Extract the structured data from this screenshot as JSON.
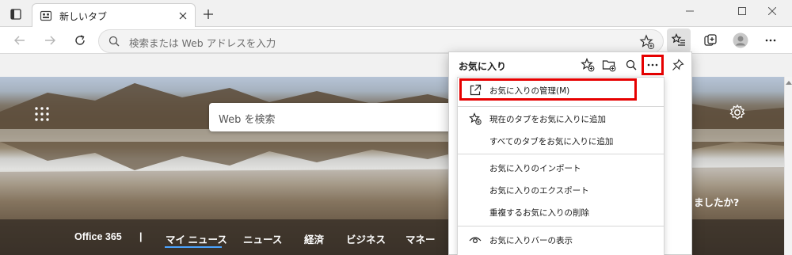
{
  "tab": {
    "title": "新しいタブ"
  },
  "address": {
    "placeholder": "検索または Web アドレスを入力"
  },
  "ntp": {
    "search_placeholder": "Web を検索",
    "teaser_text": "ましたか?",
    "feed": [
      {
        "label": "Office 365"
      },
      {
        "label": "|"
      },
      {
        "label": "マイ ニュース"
      },
      {
        "label": "ニュース"
      },
      {
        "label": "経済"
      },
      {
        "label": "ビジネス"
      },
      {
        "label": "マネー"
      }
    ]
  },
  "favorites": {
    "title": "お気に入り",
    "menu": [
      {
        "label": "お気に入りの管理(M)",
        "icon": "external-link-icon"
      },
      {
        "label": "現在のタブをお気に入りに追加",
        "icon": "star-add-icon"
      },
      {
        "label": "すべてのタブをお気に入りに追加",
        "icon": ""
      },
      {
        "label": "お気に入りのインポート",
        "icon": ""
      },
      {
        "label": "お気に入りのエクスポート",
        "icon": ""
      },
      {
        "label": "重複するお気に入りの削除",
        "icon": ""
      },
      {
        "label": "お気に入りバーの表示",
        "icon": "eye-icon"
      }
    ]
  },
  "colors": {
    "highlight": "#e60000",
    "active_underline": "#4aa3ff"
  }
}
